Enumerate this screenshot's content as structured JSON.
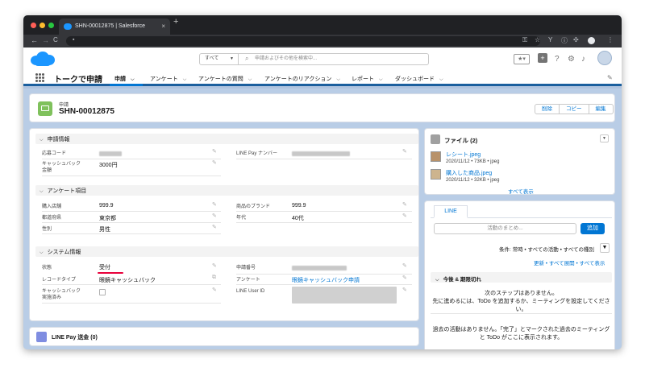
{
  "browser": {
    "tab_title": "SHN-00012875 | Salesforce",
    "tab_close": "×",
    "new_tab": "+",
    "nav_icons": {
      "back": "←",
      "forward": "→",
      "reload": "C"
    },
    "right_icons": [
      "key-icon",
      "star-icon",
      "y-icon",
      "info-icon",
      "puzzle-icon",
      "profile-icon",
      "menu-icon"
    ]
  },
  "header": {
    "search_scope": "すべて",
    "search_placeholder": "申請およびその他を検索中..."
  },
  "nav": {
    "app_name": "トークで申請",
    "items": [
      {
        "label": "申請"
      },
      {
        "label": "アンケート"
      },
      {
        "label": "アンケートの質問"
      },
      {
        "label": "アンケートのリアクション"
      },
      {
        "label": "レポート"
      },
      {
        "label": "ダッシュボード"
      }
    ]
  },
  "record": {
    "type_label": "申請",
    "name": "SHN-00012875",
    "actions": [
      "削除",
      "コピー",
      "編集"
    ]
  },
  "sections": {
    "apply_info": {
      "title": "申請情報",
      "fields": {
        "apply_code_label": "応募コード",
        "linepay_number_label": "LINE Pay ナンバー",
        "cashback_label_1": "キャッシュバック",
        "cashback_label_2": "金額",
        "cashback_value": "3000円"
      }
    },
    "survey": {
      "title": "アンケート項目",
      "fields": {
        "store_label": "購入店舗",
        "store_value": "999.9",
        "brand_label": "商品のブランド",
        "brand_value": "999.9",
        "prefecture_label": "都道府県",
        "prefecture_value": "東京都",
        "age_label": "年代",
        "age_value": "40代",
        "gender_label": "性別",
        "gender_value": "男性"
      }
    },
    "system": {
      "title": "システム情報",
      "fields": {
        "status_label": "状態",
        "status_value": "受付",
        "apply_number_label": "申請番号",
        "record_type_label": "レコードタイプ",
        "record_type_value": "眼鏡キャッシュバック",
        "survey_label": "アンケート",
        "survey_value": "眼鏡キャッシュバック申請",
        "cashback_done_label_1": "キャッシュバック",
        "cashback_done_label_2": "実施済み",
        "line_user_id_label": "LINE User ID"
      }
    },
    "linepay": {
      "title": "LINE Pay 送金 (0)"
    }
  },
  "files": {
    "title": "ファイル (2)",
    "items": [
      {
        "name": "レシート.jpeg",
        "meta": "2020/11/12 • 73KB • jpeg"
      },
      {
        "name": "購入した商品.jpeg",
        "meta": "2020/11/12 • 32KB • jpeg"
      }
    ],
    "view_all": "すべて表示"
  },
  "activity": {
    "tab": "LINE",
    "input_placeholder": "活動のまとめ...",
    "add_button": "追加",
    "filter_text": "条件: 常時 • すべての活動 • すべての種別",
    "links": "更新 • すべて展開 • すべて表示",
    "upcoming_title": "今後 & 期限切れ",
    "no_steps_1": "次のステップはありません。",
    "no_steps_2": "先に進めるには、ToDo を追加するか、ミーティングを設定してください。",
    "no_past_1": "過去の活動はありません。「完了」とマークされた過去のミーティング",
    "no_past_2": "と ToDo がここに表示されます。"
  },
  "colors": {
    "brand": "#1b96ff",
    "link": "#0176d3",
    "status_underline": "#e8003a",
    "record_icon": "#7fc15c"
  }
}
